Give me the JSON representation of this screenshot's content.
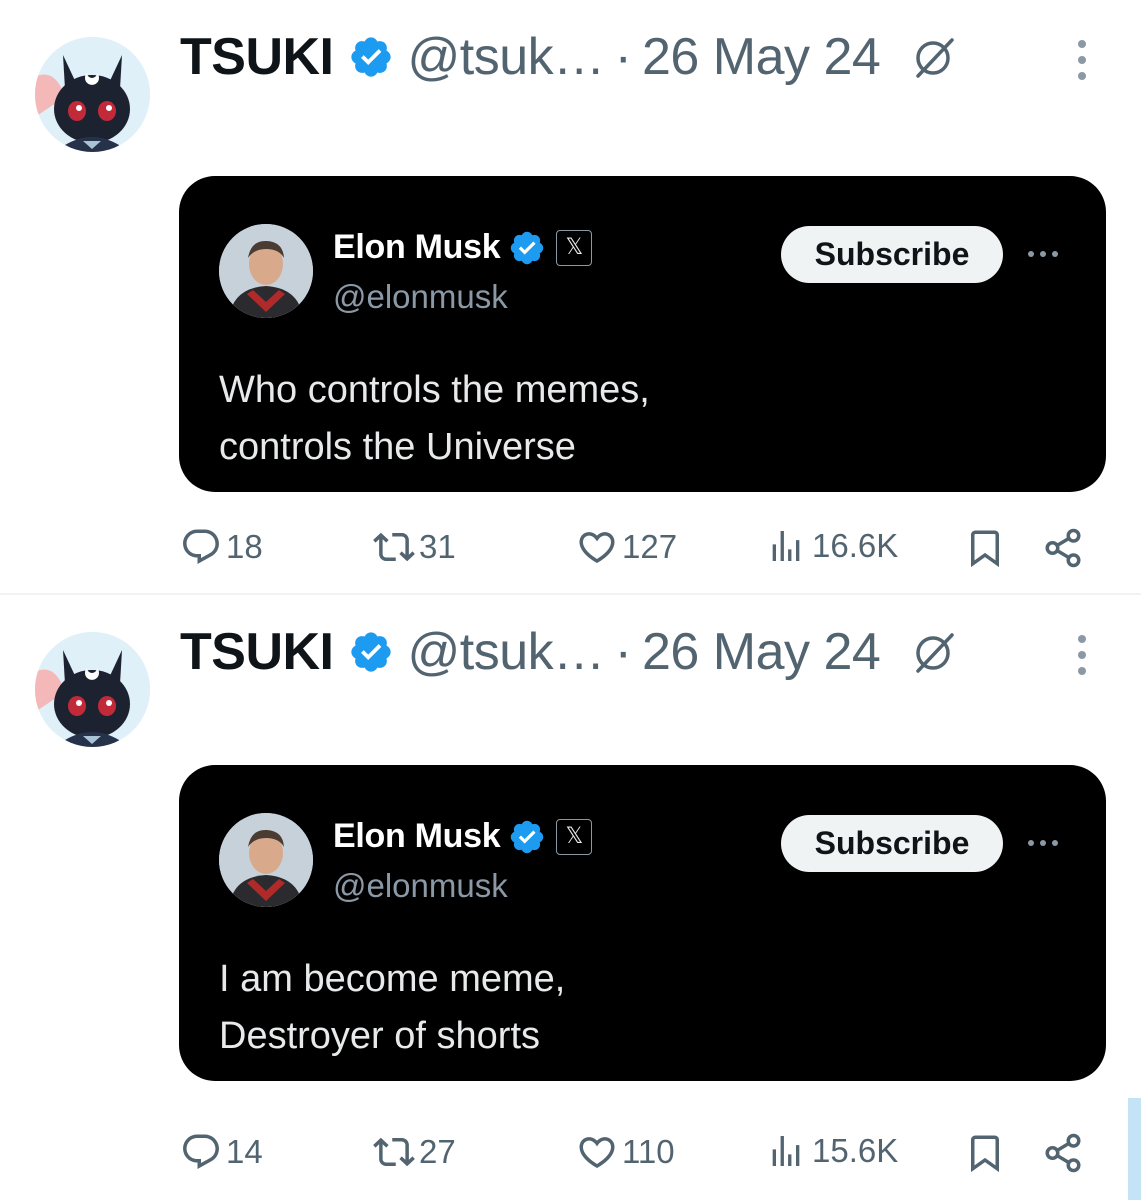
{
  "tweets": [
    {
      "author": {
        "display_name": "TSUKI",
        "handle": "@tsuk…",
        "date": "26 May 24"
      },
      "quoted": {
        "display_name": "Elon Musk",
        "handle": "@elonmusk",
        "x_badge": "𝕏",
        "subscribe_label": "Subscribe",
        "text_lines": [
          "Who controls the memes,",
          "controls the Universe"
        ]
      },
      "stats": {
        "replies": "18",
        "reposts": "31",
        "likes": "127",
        "views": "16.6K"
      }
    },
    {
      "author": {
        "display_name": "TSUKI",
        "handle": "@tsuk…",
        "date": "26 May 24"
      },
      "quoted": {
        "display_name": "Elon Musk",
        "handle": "@elonmusk",
        "x_badge": "𝕏",
        "subscribe_label": "Subscribe",
        "text_lines": [
          "I am become meme,",
          "Destroyer of shorts"
        ]
      },
      "stats": {
        "replies": "14",
        "reposts": "27",
        "likes": "110",
        "views": "15.6K"
      }
    }
  ],
  "colors": {
    "verified_blue": "#1d9bf0",
    "secondary_text": "#536471",
    "card_background": "#000000",
    "card_text": "#e7e9ea",
    "card_handle": "#8b98a5",
    "subscribe_bg": "#eff3f4"
  },
  "separator": "·"
}
